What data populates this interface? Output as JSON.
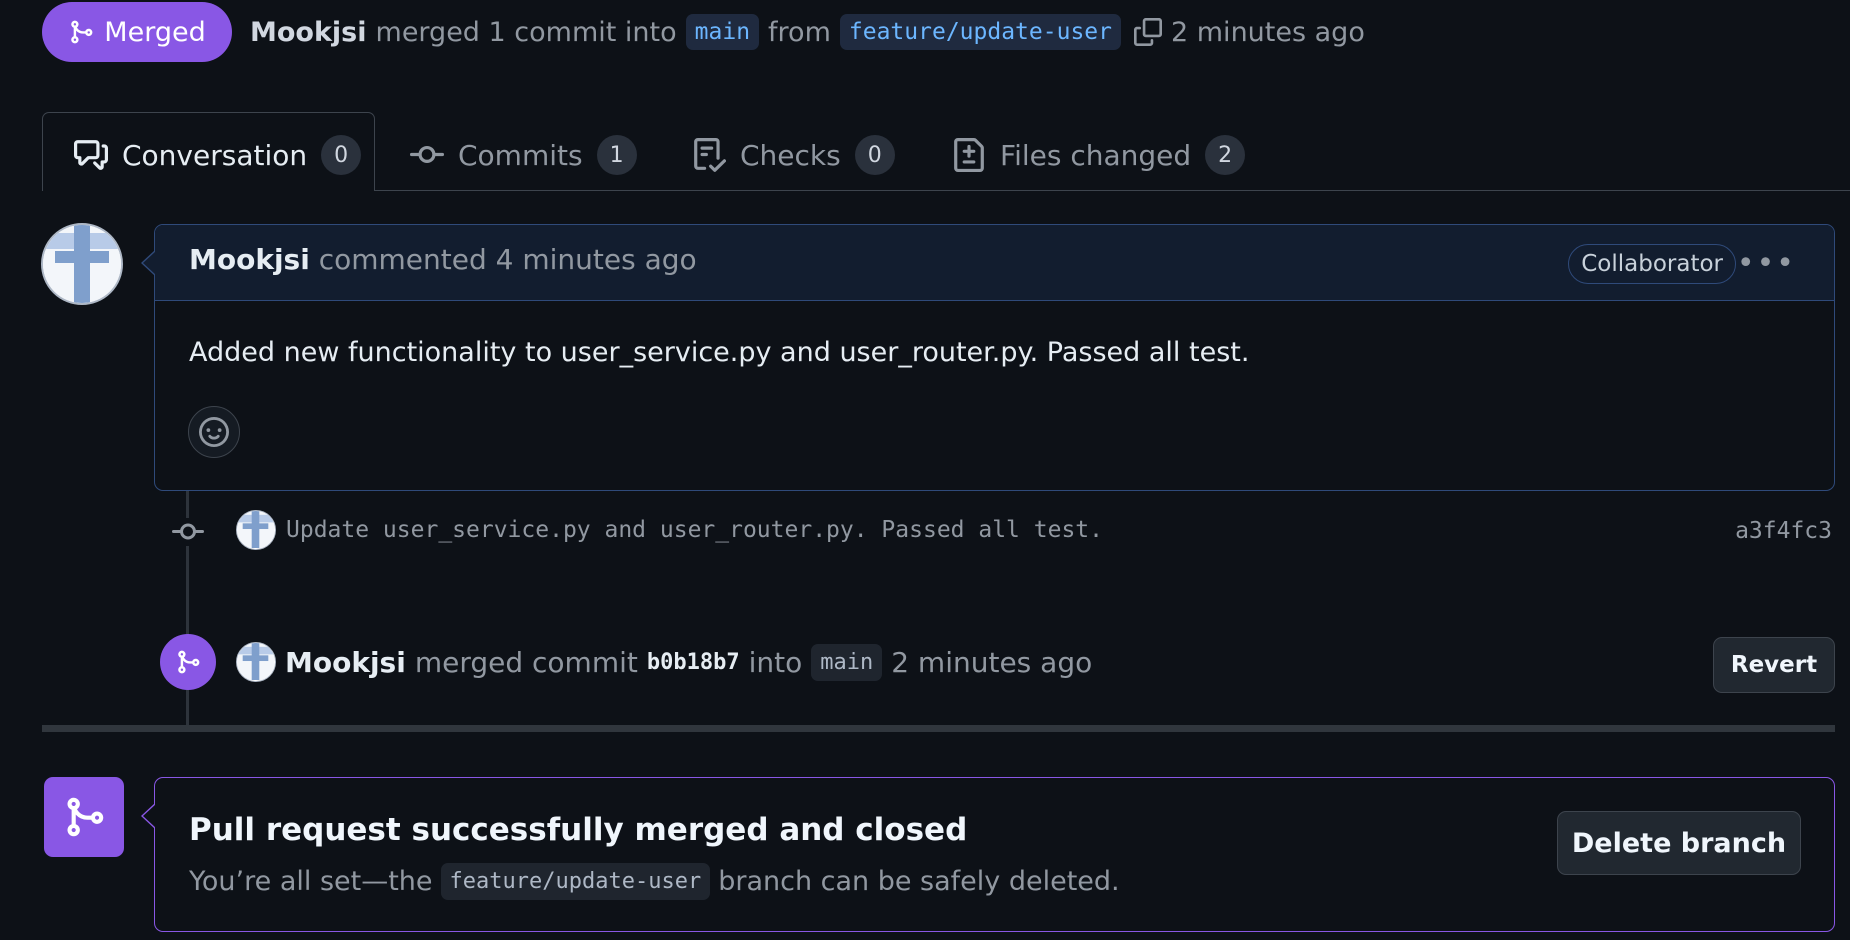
{
  "header": {
    "status_label": "Merged",
    "author": "Mookjsi",
    "action_text": "merged 1 commit into",
    "base_branch": "main",
    "from_text": "from",
    "head_branch": "feature/update-user",
    "time": "2 minutes ago"
  },
  "tabs": [
    {
      "label": "Conversation",
      "count": "0",
      "icon": "comment-discussion-icon",
      "active": true
    },
    {
      "label": "Commits",
      "count": "1",
      "icon": "git-commit-icon"
    },
    {
      "label": "Checks",
      "count": "0",
      "icon": "checklist-icon"
    },
    {
      "label": "Files changed",
      "count": "2",
      "icon": "file-diff-icon"
    }
  ],
  "comment": {
    "author": "Mookjsi",
    "meta": "commented 4 minutes ago",
    "badge": "Collaborator",
    "more": "•••",
    "body": "Added new functionality to user_service.py and user_router.py. Passed all test."
  },
  "commit": {
    "message": "Update user_service.py and user_router.py. Passed all test.",
    "sha": "a3f4fc3"
  },
  "merge_event": {
    "author": "Mookjsi",
    "text": "merged commit",
    "sha": "b0b18b7",
    "into_text": "into",
    "branch": "main",
    "time": "2 minutes ago",
    "revert_label": "Revert"
  },
  "merged_box": {
    "title": "Pull request successfully merged and closed",
    "sub_prefix": "You’re all set—the",
    "branch": "feature/update-user",
    "sub_suffix": "branch can be safely deleted.",
    "delete_label": "Delete branch"
  },
  "colors": {
    "accent_purple": "#8957e5",
    "background": "#0d1117",
    "comment_border": "#2f4a7a",
    "link_blue": "#6cb6ff"
  }
}
